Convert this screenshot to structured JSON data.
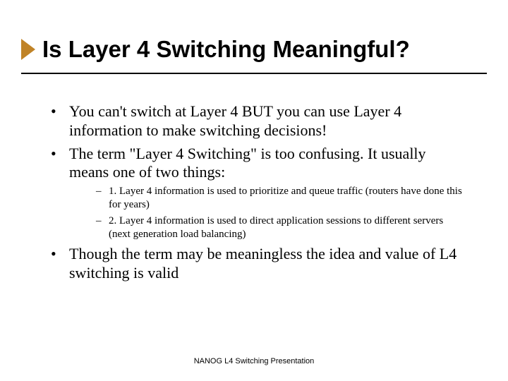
{
  "title": "Is Layer 4 Switching Meaningful?",
  "bullets": {
    "b0": "You can't switch at Layer 4 BUT you can use Layer 4 information to make switching decisions!",
    "b1": "The term \"Layer 4 Switching\" is too confusing.  It usually means one of two things:",
    "b1_sub0": "1. Layer 4 information is used to prioritize and queue traffic (routers have done this for years)",
    "b1_sub1": "2. Layer 4 information is used to direct application sessions to different servers (next generation load balancing)",
    "b2": "Though the term may be meaningless the idea and value of L4 switching is valid"
  },
  "footer": "NANOG L4 Switching Presentation",
  "accent_color": "#c08327"
}
